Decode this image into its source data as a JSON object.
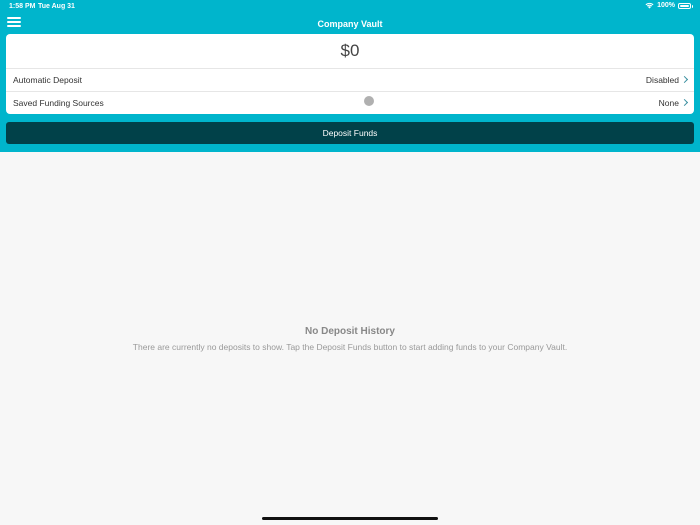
{
  "status_bar": {
    "time": "1:58 PM",
    "date": "Tue Aug 31",
    "battery": "100%"
  },
  "nav": {
    "title": "Company Vault"
  },
  "vault": {
    "balance": "$0",
    "rows": [
      {
        "label": "Automatic Deposit",
        "value": "Disabled"
      },
      {
        "label": "Saved Funding Sources",
        "value": "None"
      }
    ]
  },
  "deposit_button": {
    "label": "Deposit Funds"
  },
  "empty_state": {
    "title": "No Deposit History",
    "message": "There are currently no deposits to show. Tap the Deposit Funds button to start adding funds to your Company Vault."
  },
  "colors": {
    "header": "#00b5cc",
    "button": "#014149",
    "background": "#f7f7f7"
  }
}
